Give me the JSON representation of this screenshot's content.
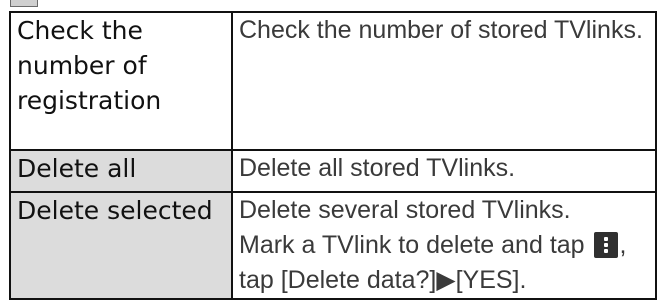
{
  "table": {
    "rows": [
      {
        "term": "Check the number of registration",
        "description": "Check the number of stored TVlinks."
      },
      {
        "term": "Delete all",
        "description": "Delete all stored TVlinks."
      },
      {
        "term": "Delete selected",
        "description_line1": "Delete several stored TVlinks.",
        "description_before_icon": "Mark a TVlink to delete and tap ",
        "description_after_icon": ",",
        "description_line3": "tap [Delete data?]▶[YES]."
      }
    ]
  },
  "icons": {
    "menu_icon": "menu-kebab-icon"
  },
  "colors": {
    "shaded_cell": "#dcdcdc",
    "border": "#111111",
    "icon_bg": "#303030"
  }
}
